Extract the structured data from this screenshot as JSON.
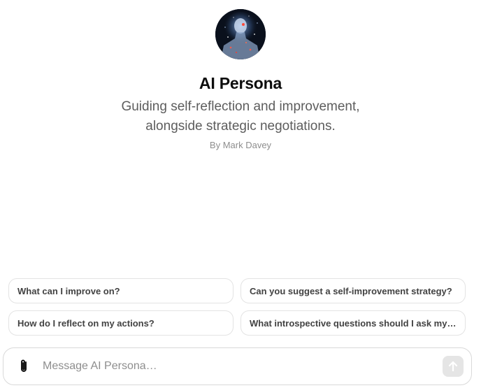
{
  "persona": {
    "name": "AI Persona",
    "description": "Guiding self-reflection and improvement, alongside strategic negotiations.",
    "byline": "By Mark Davey",
    "avatar_icon": "ai-humanoid-avatar"
  },
  "suggestions": [
    {
      "label": "What can I improve on?"
    },
    {
      "label": "Can you suggest a self-improvement strategy?"
    },
    {
      "label": "How do I reflect on my actions?"
    },
    {
      "label": "What introspective questions should I ask myself?"
    }
  ],
  "composer": {
    "placeholder": "Message AI Persona…",
    "attach_icon": "paperclip-icon",
    "send_icon": "arrow-up-icon"
  },
  "colors": {
    "text_primary": "#0d0d0d",
    "text_secondary": "#5d5d5d",
    "text_muted": "#8e8e8e",
    "border": "#e3e3e3",
    "send_disabled": "#e5e5e5"
  }
}
